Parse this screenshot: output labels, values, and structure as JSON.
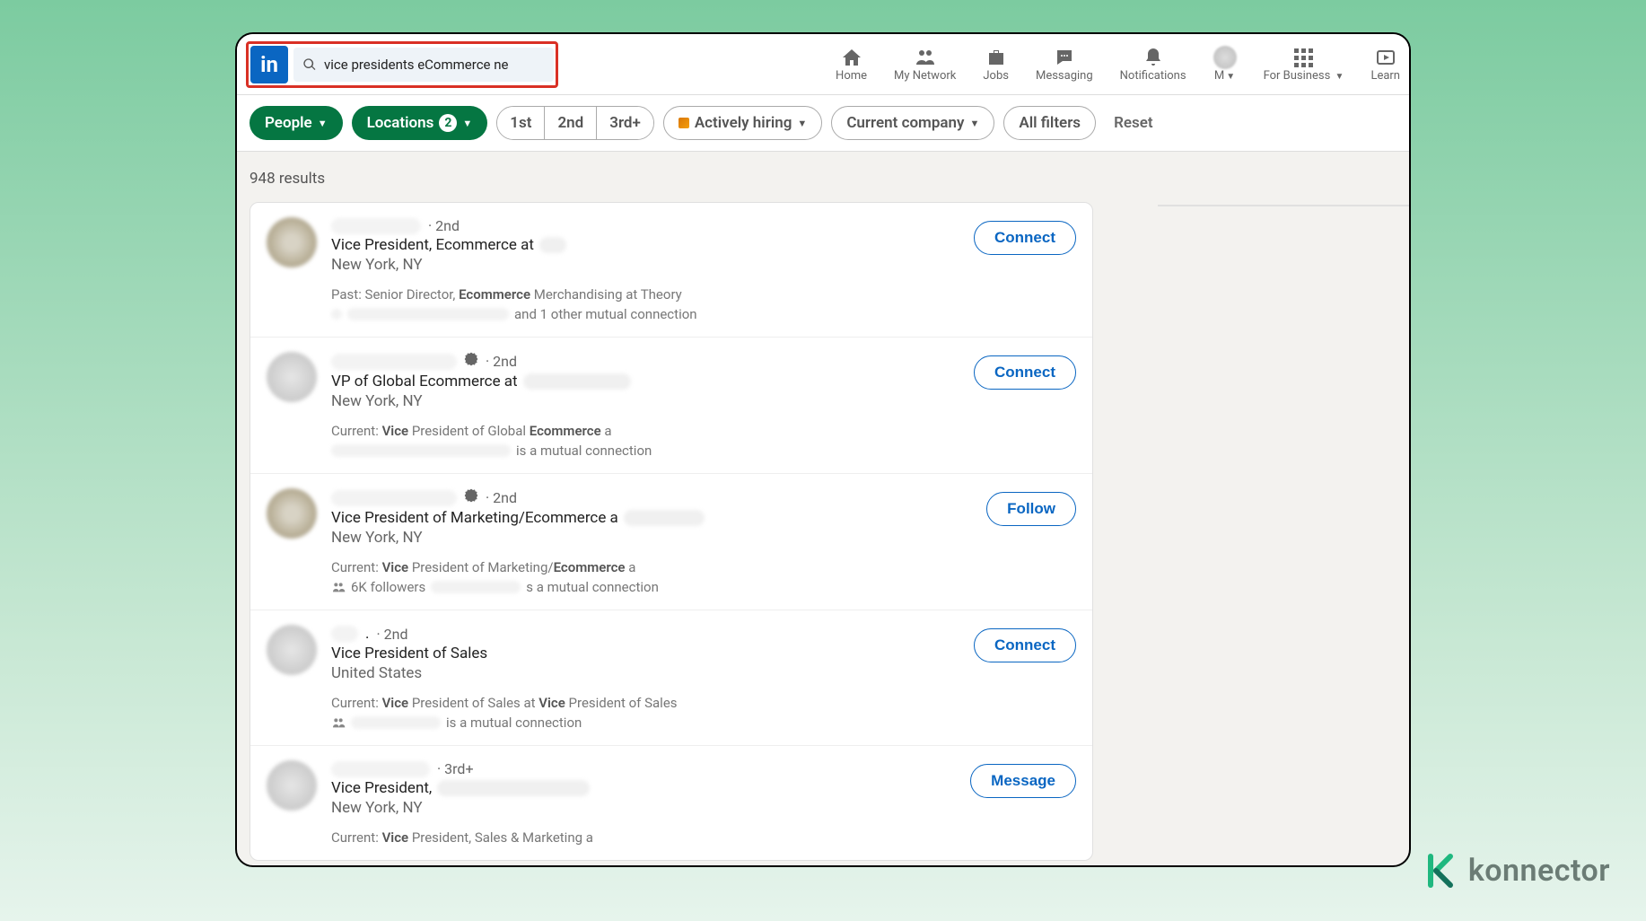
{
  "header": {
    "logo_text": "in",
    "search_value": "vice presidents eCommerce ne",
    "nav": {
      "home": "Home",
      "network": "My Network",
      "jobs": "Jobs",
      "messaging": "Messaging",
      "notifications": "Notifications",
      "me": "M",
      "business": "For Business",
      "learning": "Learn"
    }
  },
  "filters": {
    "people": "People",
    "locations_label": "Locations",
    "locations_count": "2",
    "conn1": "1st",
    "conn2": "2nd",
    "conn3": "3rd+",
    "actively_hiring": "Actively hiring",
    "current_company": "Current company",
    "all_filters": "All filters",
    "reset": "Reset"
  },
  "results_count": "948 results",
  "results": [
    {
      "degree": "· 2nd",
      "title_prefix": "Vice President, Ecommerce at",
      "location": "New York, NY",
      "meta_prefix": "Past: Senior Director, ",
      "meta_bold": "Ecommerce",
      "meta_suffix": " Merchandising at Theory",
      "mutual_suffix": "and 1 other mutual connection",
      "action": "Connect",
      "verified": false,
      "avatar_class": ""
    },
    {
      "degree": "· 2nd",
      "title_prefix": "VP of Global Ecommerce at",
      "location": "New York, NY",
      "meta_prefix": "Current: ",
      "meta_bold": "Vice",
      "meta_mid": " President of Global ",
      "meta_bold2": "Ecommerce",
      "meta_suffix": " a",
      "mutual_suffix": "is a mutual connection",
      "action": "Connect",
      "verified": true,
      "avatar_class": "gray"
    },
    {
      "degree": "· 2nd",
      "title_prefix": "Vice President of Marketing/Ecommerce a",
      "location": "New York, NY",
      "meta_prefix": "Current: ",
      "meta_bold": "Vice",
      "meta_mid": " President of Marketing/",
      "meta_bold2": "Ecommerce",
      "meta_suffix": " a",
      "mutual_prefix": "6K followers",
      "mutual_suffix": "s a mutual connection",
      "action": "Follow",
      "verified": true,
      "avatar_class": ""
    },
    {
      "degree": "· 2nd",
      "name_suffix": ". ",
      "title_prefix": "Vice President of Sales",
      "location": "United States",
      "meta_prefix": "Current: ",
      "meta_bold": "Vice",
      "meta_mid": " President of Sales at ",
      "meta_bold2": "Vice",
      "meta_suffix": " President of Sales",
      "mutual_suffix": "is a mutual connection",
      "action": "Connect",
      "verified": false,
      "avatar_class": "gray"
    },
    {
      "degree": "· 3rd+",
      "title_prefix": "Vice President,",
      "location": "New York, NY",
      "meta_prefix": "Current: ",
      "meta_bold": "Vice",
      "meta_suffix": " President, Sales & Marketing a",
      "action": "Message",
      "verified": false,
      "avatar_class": "gray"
    }
  ],
  "watermark": "konnector"
}
